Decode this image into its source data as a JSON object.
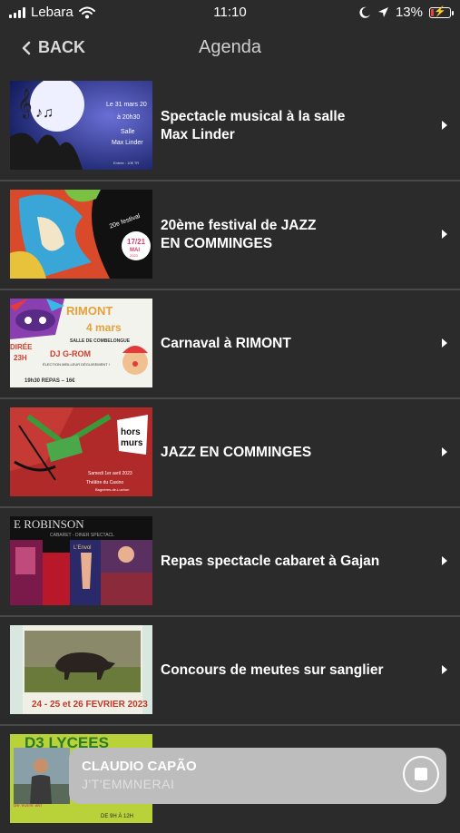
{
  "status_bar": {
    "carrier": "Lebara",
    "time": "11:10",
    "battery": "13%",
    "battery_level": 0.13,
    "icons": [
      "signal-icon",
      "wifi-icon",
      "moon-icon",
      "location-arrow-icon",
      "battery-icon"
    ]
  },
  "nav": {
    "back_label": "BACK",
    "title": "Agenda"
  },
  "events": [
    {
      "title": "Spectacle musical à la salle\nMax Linder",
      "thumb_text": [
        "Le 31 mars 20",
        "à 20h30",
        "Salle",
        "Max Linder",
        "Entrée : 10€ TR"
      ]
    },
    {
      "title": "20ème festival de JAZZ\nEN COMMINGES",
      "thumb_text": [
        "20e festival",
        "17/21",
        "MAI",
        "2023"
      ]
    },
    {
      "title": "Carnaval à RIMONT",
      "thumb_text": [
        "RIMONT",
        "4 mars",
        "SALLE DE COMBELONGUE",
        "DIRÉE",
        "23H",
        "DJ G-ROM",
        "ÉLECTION MEILLEUR DÉGUISEMENT !",
        "19h30 REPAS – 16€"
      ]
    },
    {
      "title": "JAZZ EN COMMINGES",
      "thumb_text": [
        "hors",
        "murs",
        "Samedi 1er avril 2023",
        "Théâtre du Casino",
        "Bagnères-de-Luchon"
      ]
    },
    {
      "title": "Repas spectacle cabaret à Gajan",
      "thumb_text": [
        "E ROBINSON",
        "CABARET - DINER SPECTACL",
        "L'Envol"
      ]
    },
    {
      "title": "Concours  de meutes sur sanglier",
      "thumb_text": [
        "24 - 25 et 26 FEVRIER 2023"
      ]
    }
  ],
  "partial_event": {
    "thumb_text": [
      "D3 LYCEES",
      "de votre avi",
      "DE 9H À 12H"
    ]
  },
  "player": {
    "artist": "CLAUDIO CAPÃO",
    "track": "J'T'EMMNERAI"
  },
  "colors": {
    "background": "#2b2b2b",
    "divider": "#4a4a4a",
    "player_bg": "#bdbdbd",
    "battery_low": "#e8433a"
  }
}
